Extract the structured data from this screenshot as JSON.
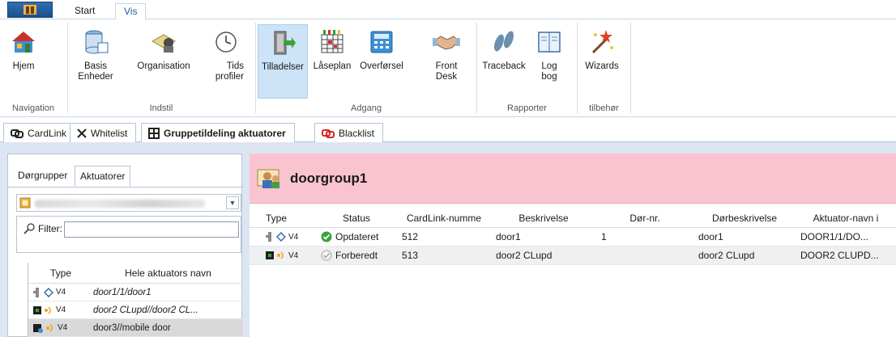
{
  "ribbon_tabs": [
    {
      "label": "Start"
    },
    {
      "label": "Vis"
    }
  ],
  "ribbon": {
    "buttons": [
      {
        "label": "Hjem",
        "icon": "home-icon"
      },
      {
        "label": "Basis Enheder",
        "icon": "database-icon"
      },
      {
        "label": "Organisation",
        "icon": "organisation-icon"
      },
      {
        "label": "Tids profiler",
        "icon": "clock-icon"
      },
      {
        "label": "Tilladelser",
        "icon": "door-permission-icon"
      },
      {
        "label": "Låseplan",
        "icon": "lock-plan-icon"
      },
      {
        "label": "Overførsel",
        "icon": "transfer-icon"
      },
      {
        "label": "Front Desk",
        "icon": "handshake-icon"
      },
      {
        "label": "Traceback",
        "icon": "footprints-icon"
      },
      {
        "label": "Log bog",
        "icon": "logbook-icon"
      },
      {
        "label": "Wizards",
        "icon": "wizard-icon"
      }
    ],
    "groups": [
      "Navigation",
      "Indstil",
      "Adgang",
      "Rapporter",
      "tilbehør"
    ]
  },
  "doc_tabs": [
    {
      "label": "CardLink",
      "icon": "link-icon"
    },
    {
      "label": "Whitelist",
      "icon": "x-icon"
    },
    {
      "label": "Gruppetildeling aktuatorer",
      "icon": "group-icon"
    },
    {
      "label": "Blacklist",
      "icon": "link-red-icon"
    }
  ],
  "left_panel": {
    "tabs": [
      "Dørgrupper",
      "Aktuatorer"
    ],
    "filter_label": "Filter:",
    "filter_value": "",
    "columns": [
      "Type",
      "Hele aktuators navn"
    ],
    "rows": [
      {
        "version": "V4",
        "name": "door1/1/door1"
      },
      {
        "version": "V4",
        "name": "door2 CLupd//door2 CL..."
      },
      {
        "version": "V4",
        "name": "door3//mobile door"
      }
    ]
  },
  "right_panel": {
    "group_name": "doorgroup1",
    "columns": [
      "Type",
      "Status",
      "CardLink-numme",
      "Beskrivelse",
      "Dør-nr.",
      "Dørbeskrivelse",
      "Aktuator-navn i"
    ],
    "rows": [
      {
        "version": "V4",
        "status": "Opdateret",
        "cardlink": "512",
        "description": "door1",
        "door_no": "1",
        "door_description": "door1",
        "actuator_name": "DOOR1/1/DO..."
      },
      {
        "version": "V4",
        "status": "Forberedt",
        "cardlink": "513",
        "description": "door2 CLupd",
        "door_no": "",
        "door_description": "door2 CLupd",
        "actuator_name": "DOOR2  CLUPD..."
      }
    ]
  },
  "colors": {
    "accent": "#1d5fa8",
    "group_header_bg": "#f9c4cf",
    "workspace_bg": "#dce6f2",
    "selected_ribbon_bg": "#cde3f7",
    "status_ok": "#3aa23a"
  }
}
